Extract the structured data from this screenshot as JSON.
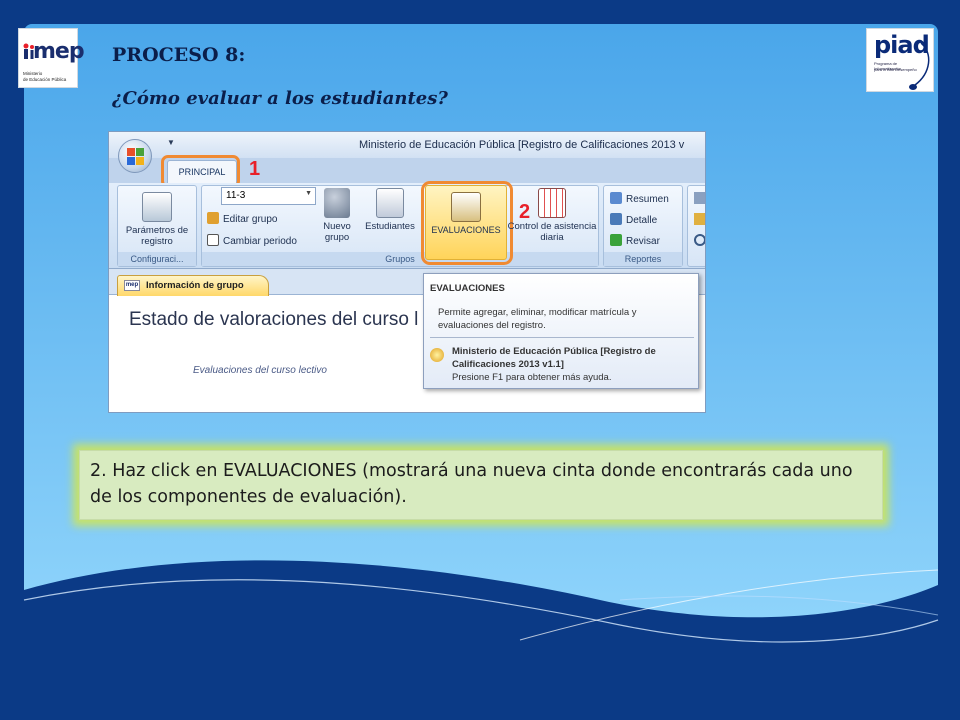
{
  "slide": {
    "title": "PROCESO 8:",
    "subtitle": "¿Cómo evaluar a los estudiantes?",
    "caption": "2. Haz click en EVALUACIONES (mostrará una nueva cinta  donde encontrarás cada uno de los componentes de evaluación).",
    "colors": {
      "background_dark": "#0b3a86",
      "panel_light": "#5fb8f2",
      "highlight_orange": "#f08a32",
      "marker_red": "#e8202a",
      "caption_bg": "#d8ebc0"
    }
  },
  "logos": {
    "mep": {
      "word": "mep",
      "line1": "Ministerio",
      "line2": "de Educación Pública"
    },
    "piad": {
      "word": "piad",
      "line1": "Programa de Informatización",
      "line2": "para el Alto Desempeño"
    }
  },
  "app": {
    "window_title": "Ministerio de Educación Pública [Registro de Calificaciones 2013 v",
    "tab_principal": "PRINCIPAL",
    "marker_1": "1",
    "marker_2": "2",
    "ribbon": {
      "config_button": "Parámetros de registro",
      "config_group": "Configuraci...",
      "grupo_selected": "11-3",
      "editar_grupo": "Editar grupo",
      "cambiar_periodo": "Cambiar periodo",
      "nuevo_grupo": "Nuevo grupo",
      "estudiantes": "Estudiantes",
      "evaluaciones": "EVALUACIONES",
      "control_asistencia": "Control de asistencia diaria",
      "grupos_group": "Grupos",
      "resumen": "Resumen",
      "detalle": "Detalle",
      "revisar": "Revisar",
      "reportes_group": "Reportes"
    },
    "document": {
      "tab_label": "Información de grupo",
      "tab_icon_text": "mep",
      "heading": "Estado de valoraciones del curso l",
      "sub_label": "Evaluaciones del curso lectivo"
    },
    "tooltip": {
      "title": "EVALUACIONES",
      "description": "Permite agregar, eliminar, modificar matrícula y evaluaciones del registro.",
      "help_title": "Ministerio de Educación Pública [Registro de Calificaciones 2013 v1.1]",
      "help_hint": "Presione F1 para obtener más ayuda."
    }
  }
}
